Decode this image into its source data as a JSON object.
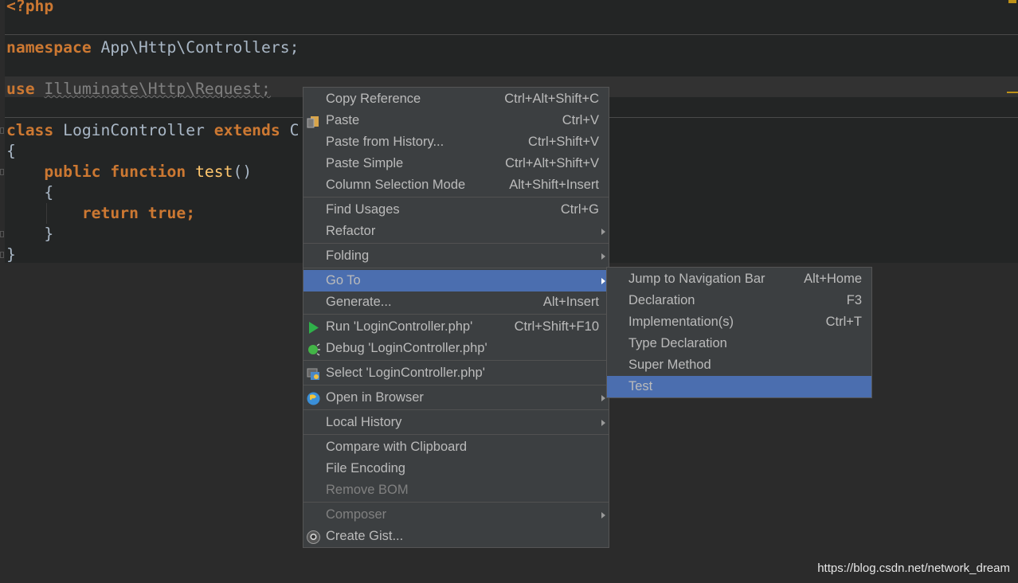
{
  "editor": {
    "lines": {
      "php_open": "<?php",
      "namespace_kw": "namespace",
      "namespace_name": " App\\Http\\Controllers;",
      "use_kw": "use",
      "use_name": "Illuminate\\Http\\Request;",
      "class_kw": "class",
      "class_name": " LoginController ",
      "extends_kw": "extends",
      "extends_rest": " C",
      "brace_open": "{",
      "public_kw": "    public function",
      "fn_name": "test",
      "fn_parens": "()",
      "brace_open2": "    {",
      "return_kw": "        return true;",
      "brace_close2": "    }",
      "brace_close": "}"
    }
  },
  "context_menu": {
    "items": [
      {
        "label": "Copy Reference",
        "shortcut": "Ctrl+Alt+Shift+C"
      },
      {
        "label": "Paste",
        "shortcut": "Ctrl+V",
        "icon": "paste-icon"
      },
      {
        "label": "Paste from History...",
        "shortcut": "Ctrl+Shift+V"
      },
      {
        "label": "Paste Simple",
        "shortcut": "Ctrl+Alt+Shift+V"
      },
      {
        "label": "Column Selection Mode",
        "shortcut": "Alt+Shift+Insert"
      },
      {
        "label": "Find Usages",
        "shortcut": "Ctrl+G"
      },
      {
        "label": "Refactor",
        "submenu": true
      },
      {
        "label": "Folding",
        "submenu": true
      },
      {
        "label": "Go To",
        "submenu": true,
        "selected": true
      },
      {
        "label": "Generate...",
        "shortcut": "Alt+Insert"
      },
      {
        "label": "Run 'LoginController.php'",
        "shortcut": "Ctrl+Shift+F10",
        "icon": "run-icon"
      },
      {
        "label": "Debug 'LoginController.php'",
        "icon": "debug-icon"
      },
      {
        "label": "Select 'LoginController.php'",
        "icon": "select-target-icon"
      },
      {
        "label": "Open in Browser",
        "submenu": true,
        "icon": "globe-icon"
      },
      {
        "label": "Local History",
        "submenu": true
      },
      {
        "label": "Compare with Clipboard"
      },
      {
        "label": "File Encoding"
      },
      {
        "label": "Remove BOM",
        "disabled": true
      },
      {
        "label": "Composer",
        "submenu": true,
        "disabled": true
      },
      {
        "label": "Create Gist...",
        "icon": "github-icon"
      }
    ]
  },
  "goto_submenu": {
    "items": [
      {
        "label": "Jump to Navigation Bar",
        "shortcut": "Alt+Home"
      },
      {
        "label": "Declaration",
        "shortcut": "F3"
      },
      {
        "label": "Implementation(s)",
        "shortcut": "Ctrl+T"
      },
      {
        "label": "Type Declaration"
      },
      {
        "label": "Super Method"
      },
      {
        "label": "Test",
        "selected": true
      }
    ]
  },
  "watermark": "https://blog.csdn.net/network_dream",
  "colors": {
    "selection": "#4b6eaf",
    "keyword": "#cc7832",
    "function": "#ffc66d",
    "menu_bg": "#3c3f41"
  }
}
